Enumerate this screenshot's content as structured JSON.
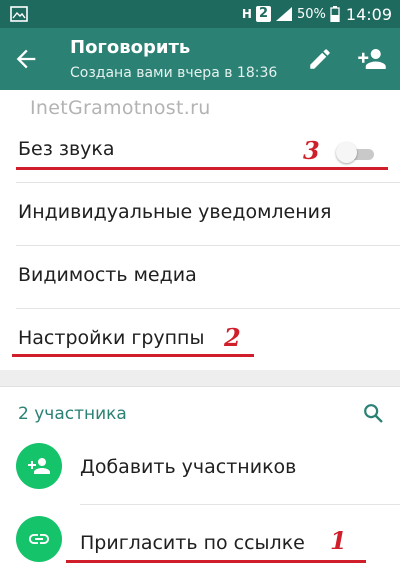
{
  "status_bar": {
    "network_letter": "H",
    "sim_number": "2",
    "battery_percent": "50%",
    "time": "14:09"
  },
  "header": {
    "title": "Поговорить",
    "subtitle": "Создана вами вчера в 18:36"
  },
  "watermark": "InetGramotnost.ru",
  "settings": {
    "mute_label": "Без звука",
    "mute_enabled": false,
    "custom_notifications_label": "Индивидуальные уведомления",
    "media_visibility_label": "Видимость медиа",
    "group_settings_label": "Настройки группы"
  },
  "participants": {
    "count_label": "2 участника",
    "add_label": "Добавить участников",
    "invite_label": "Пригласить по ссылке"
  },
  "annotations": {
    "mute": "3",
    "group_settings": "2",
    "invite": "1"
  },
  "colors": {
    "header": "#2b8174",
    "status_bar": "#1f6a5f",
    "accent_green": "#14c36a",
    "annotation_red": "#d01f2b"
  }
}
